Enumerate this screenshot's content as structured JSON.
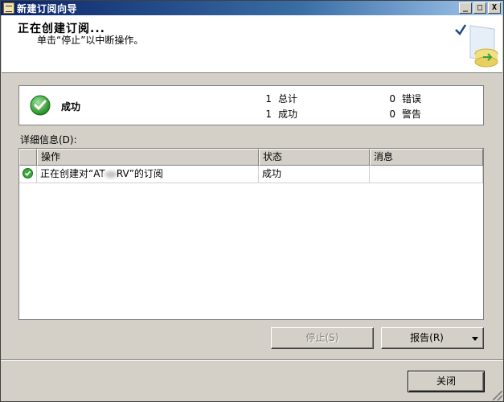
{
  "window": {
    "title": "新建订阅向导",
    "controls": {
      "minimize": "_",
      "maximize": "□",
      "close": "X"
    }
  },
  "header": {
    "title": "正在创建订阅...",
    "subtitle": "单击“停止”以中断操作。"
  },
  "summary": {
    "status": "成功",
    "status_icon": "success-check-icon",
    "total_count": "1",
    "total_label": "总计",
    "success_count": "1",
    "success_label": "成功",
    "error_count": "0",
    "error_label": "错误",
    "warning_count": "0",
    "warning_label": "警告"
  },
  "details": {
    "label": "详细信息(D):",
    "columns": [
      "操作",
      "状态",
      "消息"
    ],
    "rows": [
      {
        "action_prefix": "正在创建对“AT",
        "action_suffix": "RV”的订阅",
        "status": "成功",
        "message": ""
      }
    ]
  },
  "buttons": {
    "stop": "停止(S)",
    "report": "报告(R)",
    "close": "关闭"
  },
  "colors": {
    "titlebar_start": "#0a246a",
    "titlebar_end": "#a6caf0",
    "window_bg": "#d4d0c8",
    "success_green": "#2e9b2e"
  }
}
